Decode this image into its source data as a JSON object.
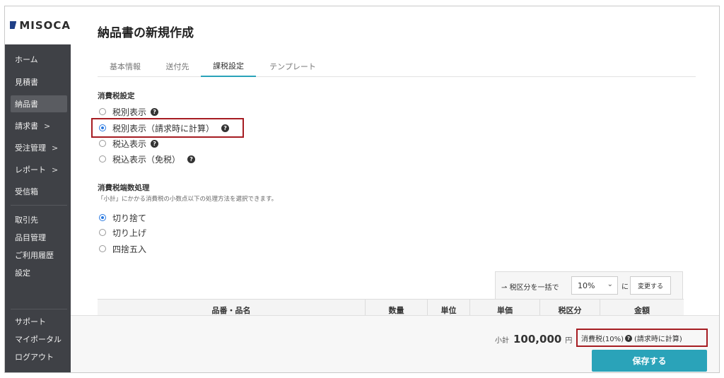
{
  "app": {
    "logo_text": "MISOCA"
  },
  "sidebar": {
    "items": [
      {
        "label": "ホーム",
        "chevron": ""
      },
      {
        "label": "見積書",
        "chevron": ""
      },
      {
        "label": "納品書",
        "chevron": ""
      },
      {
        "label": "請求書",
        "chevron": ">"
      },
      {
        "label": "受注管理",
        "chevron": ">"
      },
      {
        "label": "レポート",
        "chevron": ">"
      },
      {
        "label": "受信箱",
        "chevron": ""
      },
      {
        "label": "取引先",
        "chevron": ""
      },
      {
        "label": "品目管理",
        "chevron": ""
      },
      {
        "label": "ご利用履歴",
        "chevron": ""
      },
      {
        "label": "設定",
        "chevron": ""
      },
      {
        "label": "サポート",
        "chevron": ""
      },
      {
        "label": "マイポータル",
        "chevron": ""
      },
      {
        "label": "ログアウト",
        "chevron": ""
      }
    ]
  },
  "page": {
    "title": "納品書の新規作成"
  },
  "tabs": [
    {
      "label": "基本情報"
    },
    {
      "label": "送付先"
    },
    {
      "label": "課税設定"
    },
    {
      "label": "テンプレート"
    }
  ],
  "tax_display": {
    "label": "消費税設定",
    "options": [
      {
        "label": "税別表示",
        "checked": false
      },
      {
        "label": "税別表示（請求時に計算）",
        "checked": true
      },
      {
        "label": "税込表示",
        "checked": false
      },
      {
        "label": "税込表示（免税）",
        "checked": false
      }
    ]
  },
  "rounding": {
    "label": "消費税端数処理",
    "hint": "「小計」にかかる消費税の小数点以下の処理方法を選択できます。",
    "options": [
      {
        "label": "切り捨て",
        "checked": true
      },
      {
        "label": "切り上げ",
        "checked": false
      },
      {
        "label": "四捨五入",
        "checked": false
      }
    ]
  },
  "bulk_tax": {
    "label": "税区分を一括で",
    "selected": "10%",
    "particle": "に",
    "button": "変更する"
  },
  "table": {
    "headers": [
      "品番・品名",
      "数量",
      "単位",
      "単価",
      "税区分",
      "金額"
    ]
  },
  "footer": {
    "subtotal_label": "小計",
    "subtotal_value": "100,000",
    "subtotal_unit": "円",
    "tax_label": "消費税(10%)",
    "tax_note": "(請求時に計算)",
    "save_label": "保存する"
  },
  "colors": {
    "accent": "#2aa3b9",
    "sidebar": "#3f4146",
    "highlight": "#a61c22",
    "radio": "#2a79e0"
  }
}
